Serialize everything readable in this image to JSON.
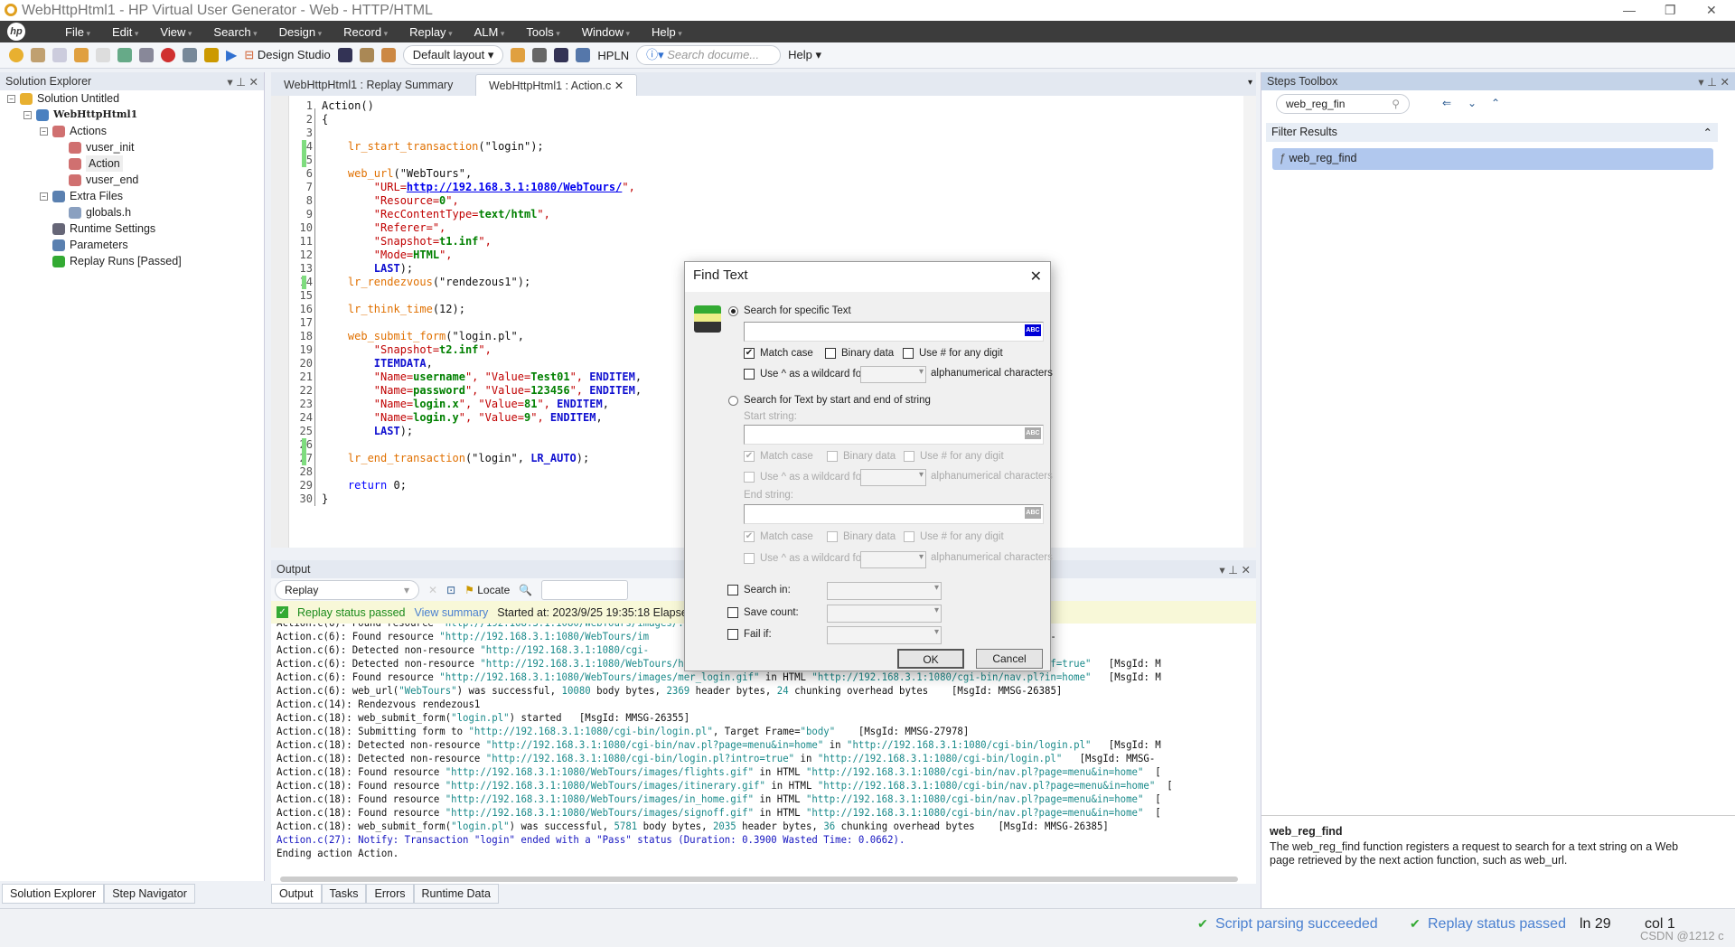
{
  "window": {
    "title": "WebHttpHtml1 - HP Virtual User Generator - Web - HTTP/HTML"
  },
  "menu": [
    "File",
    "Edit",
    "View",
    "Search",
    "Design",
    "Record",
    "Replay",
    "ALM",
    "Tools",
    "Window",
    "Help"
  ],
  "toolbar": {
    "design_studio": "Design Studio",
    "layout": "Default layout",
    "hpln": "HPLN",
    "search_placeholder": "Search docume...",
    "help": "Help"
  },
  "solution_explorer": {
    "title": "Solution Explorer",
    "items": [
      {
        "label": "Solution Untitled",
        "level": 0
      },
      {
        "label": "WebHttpHtml1",
        "level": 1
      },
      {
        "label": "Actions",
        "level": 2
      },
      {
        "label": "vuser_init",
        "level": 3
      },
      {
        "label": "Action",
        "level": 3
      },
      {
        "label": "vuser_end",
        "level": 3
      },
      {
        "label": "Extra Files",
        "level": 2
      },
      {
        "label": "globals.h",
        "level": 3
      },
      {
        "label": "Runtime Settings",
        "level": 2
      },
      {
        "label": "Parameters",
        "level": 2
      },
      {
        "label": "Replay Runs [Passed]",
        "level": 2
      }
    ],
    "bottom_tabs": [
      "Solution Explorer",
      "Step Navigator"
    ]
  },
  "editor": {
    "tabs": [
      "WebHttpHtml1 : Replay Summary",
      "WebHttpHtml1 : Action.c"
    ],
    "active_tab": 1,
    "changed_lines": [
      4,
      5,
      14,
      26,
      27
    ],
    "lines": [
      [
        [
          "Action()",
          "tx"
        ]
      ],
      [
        [
          "{",
          "tx"
        ]
      ],
      [],
      [
        [
          "    lr_start_transaction",
          "fn"
        ],
        [
          "(\"login\");",
          "tx"
        ]
      ],
      [],
      [
        [
          "    web_url",
          "fn"
        ],
        [
          "(\"WebTours\",",
          "tx"
        ]
      ],
      [
        [
          "        \"URL=",
          "rs"
        ],
        [
          "http://192.168.3.1:1080/WebTours/",
          "ur"
        ],
        [
          "\",",
          "rs"
        ]
      ],
      [
        [
          "        \"Resource=",
          "rs"
        ],
        [
          "0",
          "vl"
        ],
        [
          "\",",
          "rs"
        ]
      ],
      [
        [
          "        \"RecContentType=",
          "rs"
        ],
        [
          "text/html",
          "vl"
        ],
        [
          "\",",
          "rs"
        ]
      ],
      [
        [
          "        \"Referer=\",",
          "rs"
        ]
      ],
      [
        [
          "        \"Snapshot=",
          "rs"
        ],
        [
          "t1.inf",
          "vl"
        ],
        [
          "\",",
          "rs"
        ]
      ],
      [
        [
          "        \"Mode=",
          "rs"
        ],
        [
          "HTML",
          "vl"
        ],
        [
          "\",",
          "rs"
        ]
      ],
      [
        [
          "        LAST",
          "kw"
        ],
        [
          ");",
          "tx"
        ]
      ],
      [
        [
          "    lr_rendezvous",
          "fn"
        ],
        [
          "(\"rendezous1\");",
          "tx"
        ]
      ],
      [],
      [
        [
          "    lr_think_time",
          "fn"
        ],
        [
          "(12);",
          "tx"
        ]
      ],
      [],
      [
        [
          "    web_submit_form",
          "fn"
        ],
        [
          "(\"login.pl\",",
          "tx"
        ]
      ],
      [
        [
          "        \"Snapshot=",
          "rs"
        ],
        [
          "t2.inf",
          "vl"
        ],
        [
          "\",",
          "rs"
        ]
      ],
      [
        [
          "        ITEMDATA",
          "kw"
        ],
        [
          ",",
          "tx"
        ]
      ],
      [
        [
          "        \"Name=",
          "rs"
        ],
        [
          "username",
          "vl"
        ],
        [
          "\", \"Value=",
          "rs"
        ],
        [
          "Test01",
          "vl"
        ],
        [
          "\", ",
          "rs"
        ],
        [
          "ENDITEM",
          "kw"
        ],
        [
          ",",
          "tx"
        ]
      ],
      [
        [
          "        \"Name=",
          "rs"
        ],
        [
          "password",
          "vl"
        ],
        [
          "\", \"Value=",
          "rs"
        ],
        [
          "123456",
          "vl"
        ],
        [
          "\", ",
          "rs"
        ],
        [
          "ENDITEM",
          "kw"
        ],
        [
          ",",
          "tx"
        ]
      ],
      [
        [
          "        \"Name=",
          "rs"
        ],
        [
          "login.x",
          "vl"
        ],
        [
          "\", \"Value=",
          "rs"
        ],
        [
          "81",
          "vl"
        ],
        [
          "\", ",
          "rs"
        ],
        [
          "ENDITEM",
          "kw"
        ],
        [
          ",",
          "tx"
        ]
      ],
      [
        [
          "        \"Name=",
          "rs"
        ],
        [
          "login.y",
          "vl"
        ],
        [
          "\", \"Value=",
          "rs"
        ],
        [
          "9",
          "vl"
        ],
        [
          "\", ",
          "rs"
        ],
        [
          "ENDITEM",
          "kw"
        ],
        [
          ",",
          "tx"
        ]
      ],
      [
        [
          "        LAST",
          "kw"
        ],
        [
          ");",
          "tx"
        ]
      ],
      [],
      [
        [
          "    lr_end_transaction",
          "fn"
        ],
        [
          "(\"login\", ",
          "tx"
        ],
        [
          "LR_AUTO",
          "kw"
        ],
        [
          ");",
          "tx"
        ]
      ],
      [],
      [
        [
          "    return ",
          "rt"
        ],
        [
          "0;",
          "tx"
        ]
      ],
      [
        [
          "}",
          "tx"
        ]
      ]
    ]
  },
  "output": {
    "title": "Output",
    "filter": "Replay",
    "locate": "Locate",
    "status": "Replay status passed",
    "view_summary": "View summary",
    "started": "Started at: 2023/9/25 19:35:18 Elapsed",
    "lines": [
      [
        [
          "Action.c(6): Found resource ",
          "t"
        ],
        [
          "\"http://192.168.3.1:1080/WebTours/images/...header.html\"",
          "u"
        ]
      ],
      [
        [
          "Action.c(6): Found resource ",
          "t"
        ],
        [
          "\"http://192.168.3.1:1080/WebTours/im",
          "u"
        ],
        [
          "                                        ",
          "t"
        ],
        [
          "s/header.html\"",
          "u"
        ],
        [
          "   [MsgId: MMSG-",
          "t"
        ]
      ],
      [
        [
          "Action.c(6): Detected non-resource ",
          "t"
        ],
        [
          "\"http://192.168.3.1:1080/cgi-",
          "u"
        ],
        [
          "                                  ",
          "t"
        ],
        [
          "lcome.pl?signOff=true\"",
          "u"
        ],
        [
          "   [Msg",
          "t"
        ]
      ],
      [
        [
          "Action.c(6): Detected non-resource ",
          "t"
        ],
        [
          "\"http://192.168.3.1:1080/WebTours/home.html\"",
          "u"
        ],
        [
          " in ",
          "t"
        ],
        [
          "\"http://192.168.3.1:1080/cgi-bin/welcome.pl?signOff=true\"",
          "u"
        ],
        [
          "   [MsgId: M",
          "t"
        ]
      ],
      [
        [
          "Action.c(6): Found resource ",
          "t"
        ],
        [
          "\"http://192.168.3.1:1080/WebTours/images/mer_login.gif\"",
          "u"
        ],
        [
          " in HTML ",
          "t"
        ],
        [
          "\"http://192.168.3.1:1080/cgi-bin/nav.pl?in=home\"",
          "u"
        ],
        [
          "   [MsgId: M",
          "t"
        ]
      ],
      [
        [
          "Action.c(6): web_url(",
          "t"
        ],
        [
          "\"WebTours\"",
          "u"
        ],
        [
          ") was successful, ",
          "t"
        ],
        [
          "10080",
          "u"
        ],
        [
          " body bytes, ",
          "t"
        ],
        [
          "2369",
          "u"
        ],
        [
          " header bytes, ",
          "t"
        ],
        [
          "24",
          "u"
        ],
        [
          " chunking overhead bytes    [MsgId: MMSG-26385]",
          "t"
        ]
      ],
      [
        [
          "Action.c(14): Rendezvous rendezous1",
          "t"
        ]
      ],
      [
        [
          "Action.c(18): web_submit_form(",
          "t"
        ],
        [
          "\"login.pl\"",
          "u"
        ],
        [
          ") started   [MsgId: MMSG-26355]",
          "t"
        ]
      ],
      [
        [
          "Action.c(18): Submitting form to ",
          "t"
        ],
        [
          "\"http://192.168.3.1:1080/cgi-bin/login.pl\"",
          "u"
        ],
        [
          ", Target Frame=",
          "t"
        ],
        [
          "\"body\"",
          "u"
        ],
        [
          "    [MsgId: MMSG-27978]",
          "t"
        ]
      ],
      [
        [
          "Action.c(18): Detected non-resource ",
          "t"
        ],
        [
          "\"http://192.168.3.1:1080/cgi-bin/nav.pl?page=menu&in=home\"",
          "u"
        ],
        [
          " in ",
          "t"
        ],
        [
          "\"http://192.168.3.1:1080/cgi-bin/login.pl\"",
          "u"
        ],
        [
          "   [MsgId: M",
          "t"
        ]
      ],
      [
        [
          "Action.c(18): Detected non-resource ",
          "t"
        ],
        [
          "\"http://192.168.3.1:1080/cgi-bin/login.pl?intro=true\"",
          "u"
        ],
        [
          " in ",
          "t"
        ],
        [
          "\"http://192.168.3.1:1080/cgi-bin/login.pl\"",
          "u"
        ],
        [
          "   [MsgId: MMSG-",
          "t"
        ]
      ],
      [
        [
          "Action.c(18): Found resource ",
          "t"
        ],
        [
          "\"http://192.168.3.1:1080/WebTours/images/flights.gif\"",
          "u"
        ],
        [
          " in HTML ",
          "t"
        ],
        [
          "\"http://192.168.3.1:1080/cgi-bin/nav.pl?page=menu&in=home\"",
          "u"
        ],
        [
          "  [",
          "t"
        ]
      ],
      [
        [
          "Action.c(18): Found resource ",
          "t"
        ],
        [
          "\"http://192.168.3.1:1080/WebTours/images/itinerary.gif\"",
          "u"
        ],
        [
          " in HTML ",
          "t"
        ],
        [
          "\"http://192.168.3.1:1080/cgi-bin/nav.pl?page=menu&in=home\"",
          "u"
        ],
        [
          "  [",
          "t"
        ]
      ],
      [
        [
          "Action.c(18): Found resource ",
          "t"
        ],
        [
          "\"http://192.168.3.1:1080/WebTours/images/in_home.gif\"",
          "u"
        ],
        [
          " in HTML ",
          "t"
        ],
        [
          "\"http://192.168.3.1:1080/cgi-bin/nav.pl?page=menu&in=home\"",
          "u"
        ],
        [
          "  [",
          "t"
        ]
      ],
      [
        [
          "Action.c(18): Found resource ",
          "t"
        ],
        [
          "\"http://192.168.3.1:1080/WebTours/images/signoff.gif\"",
          "u"
        ],
        [
          " in HTML ",
          "t"
        ],
        [
          "\"http://192.168.3.1:1080/cgi-bin/nav.pl?page=menu&in=home\"",
          "u"
        ],
        [
          "  [",
          "t"
        ]
      ],
      [
        [
          "Action.c(18): web_submit_form(",
          "t"
        ],
        [
          "\"login.pl\"",
          "u"
        ],
        [
          ") was successful, ",
          "t"
        ],
        [
          "5781",
          "u"
        ],
        [
          " body bytes, ",
          "t"
        ],
        [
          "2035",
          "u"
        ],
        [
          " header bytes, ",
          "t"
        ],
        [
          "36",
          "u"
        ],
        [
          " chunking overhead bytes    [MsgId: MMSG-26385]",
          "t"
        ]
      ],
      [
        [
          "Action.c(27): Notify: Transaction \"login\" ended with a \"Pass\" status (Duration: 0.3900 Wasted Time: 0.0662).",
          "b"
        ]
      ],
      [
        [
          "Ending action Action.",
          "t"
        ]
      ]
    ],
    "bottom_tabs": [
      "Output",
      "Tasks",
      "Errors",
      "Runtime Data"
    ]
  },
  "steps_toolbox": {
    "title": "Steps Toolbox",
    "search_value": "web_reg_fin",
    "filter_results": "Filter Results",
    "result": "web_reg_find",
    "help_title": "web_reg_find",
    "help_text": "The web_reg_find function registers a request to search for a text string on a Web page retrieved by the next action function, such as web_url."
  },
  "statusbar": {
    "parsing": "Script parsing succeeded",
    "replay": "Replay status passed",
    "ln": "ln 29",
    "col": "col 1",
    "watermark": "CSDN @1212 c"
  },
  "dialog": {
    "title": "Find Text",
    "opt1": "Search for specific Text",
    "match_case": "Match case",
    "binary": "Binary data",
    "digit": "Use # for any digit",
    "wildcard": "Use ^ as a wildcard for",
    "alnum": "alphanumerical characters",
    "opt2": "Search for Text by start and end of string",
    "start": "Start string:",
    "end": "End string:",
    "search_in": "Search in:",
    "save_count": "Save count:",
    "fail_if": "Fail if:",
    "ok": "OK",
    "cancel": "Cancel",
    "selected_option": 1
  }
}
